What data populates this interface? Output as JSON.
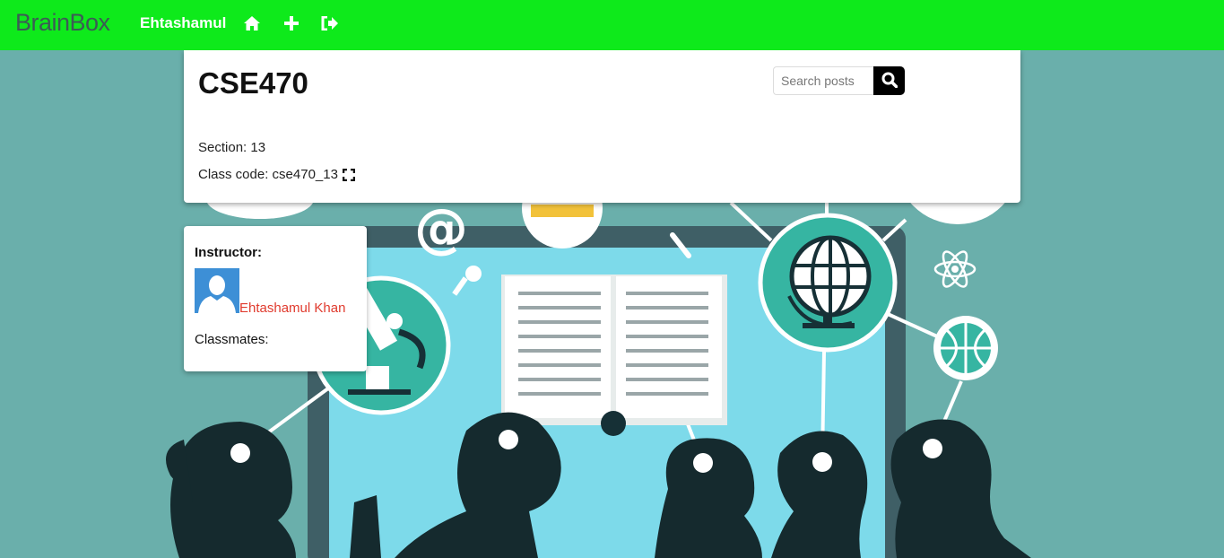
{
  "navbar": {
    "brand": "BrainBox",
    "user": "Ehtashamul",
    "icons": [
      "home-icon",
      "plus-icon",
      "sign-out-icon"
    ]
  },
  "course": {
    "title": "CSE470",
    "section_text": "Section: 13",
    "class_code_text": "Class code: cse470_13"
  },
  "search": {
    "placeholder": "Search posts"
  },
  "people": {
    "instructor_heading": "Instructor:",
    "instructor_name": "Ehtashamul Khan",
    "classmates_heading": "Classmates:"
  },
  "colors": {
    "navbar": "#0eea1b",
    "background": "#6aafab",
    "brand": "#3c5c55",
    "instructor_link": "#e03b2e"
  }
}
